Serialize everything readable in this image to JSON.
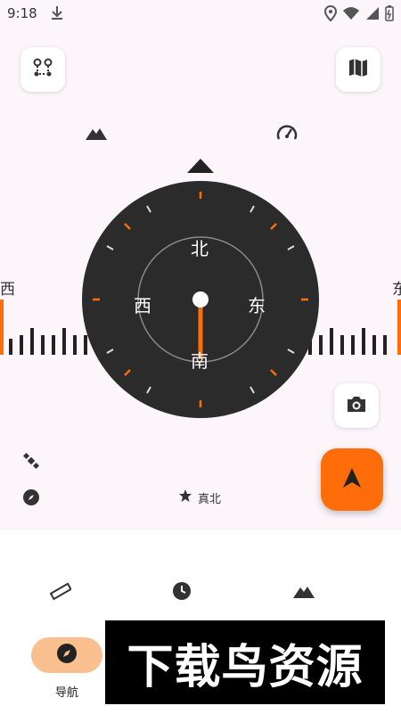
{
  "status_bar": {
    "time": "9:18",
    "icons": [
      "download-icon",
      "location-icon",
      "wifi-icon",
      "signal-icon",
      "battery-icon"
    ]
  },
  "toolbar": {
    "left_button_icon": "route-icon",
    "right_button_icon": "map-icon"
  },
  "stats": {
    "left_icon": "mountain-icon",
    "right_icon": "speedometer-icon"
  },
  "compass": {
    "north_label": "北",
    "east_label": "东",
    "south_label": "南",
    "west_label": "西",
    "needle_color": "#ff6d0a",
    "dial_color": "#2b2b2b"
  },
  "heading_tape": {
    "left_label": "西",
    "right_label": "东",
    "accent_color": "#ff6d0a"
  },
  "reference": {
    "icon": "star-icon",
    "text": "真北"
  },
  "side_icons": [
    "satellite-icon",
    "compass-icon"
  ],
  "camera_button_icon": "camera-icon",
  "fab_icon": "navigation-arrow-icon",
  "bottom_nav": {
    "items": [
      {
        "icon": "ruler-icon"
      },
      {
        "icon": "clock-icon"
      },
      {
        "icon": "mountain-icon"
      }
    ],
    "active": {
      "icon": "compass-icon",
      "label": "导航"
    }
  },
  "watermark": {
    "text": "下载鸟资源"
  }
}
